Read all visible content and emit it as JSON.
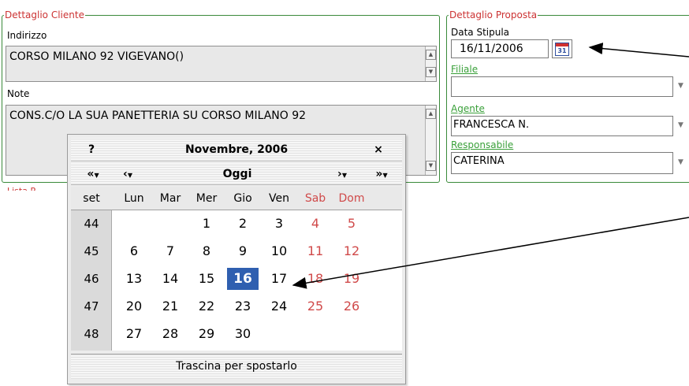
{
  "cliente": {
    "legend": "Dettaglio Cliente",
    "indirizzo_label": "Indirizzo",
    "indirizzo_value": "CORSO MILANO 92 VIGEVANO()",
    "note_label": "Note",
    "note_value": "CONS.C/O LA SUA PANETTERIA SU CORSO MILANO 92",
    "partial_label": "Lista P"
  },
  "proposta": {
    "legend": "Dettaglio Proposta",
    "data_stipula_label": "Data Stipula",
    "data_stipula_value": "16/11/2006",
    "calendar_icon_text": "31",
    "filiale_label": "Filiale",
    "filiale_value": "",
    "agente_label": "Agente",
    "agente_value": "FRANCESCA N.",
    "responsabile_label": "Responsabile",
    "responsabile_value": "CATERINA"
  },
  "calendar": {
    "help": "?",
    "title": "Novembre, 2006",
    "close": "×",
    "prev_year": "«",
    "prev_month": "‹",
    "today": "Oggi",
    "next_month": "›",
    "next_year": "»",
    "week_header": "set",
    "weekdays": [
      "Lun",
      "Mar",
      "Mer",
      "Gio",
      "Ven",
      "Sab",
      "Dom"
    ],
    "weeks": [
      {
        "week": "44",
        "days": [
          "",
          "",
          "1",
          "2",
          "3",
          "4",
          "5"
        ]
      },
      {
        "week": "45",
        "days": [
          "6",
          "7",
          "8",
          "9",
          "10",
          "11",
          "12"
        ]
      },
      {
        "week": "46",
        "days": [
          "13",
          "14",
          "15",
          "16",
          "17",
          "18",
          "19"
        ]
      },
      {
        "week": "47",
        "days": [
          "20",
          "21",
          "22",
          "23",
          "24",
          "25",
          "26"
        ]
      },
      {
        "week": "48",
        "days": [
          "27",
          "28",
          "29",
          "30",
          "",
          "",
          ""
        ]
      }
    ],
    "selected_day": "16",
    "footer": "Trascina per spostarlo"
  },
  "colors": {
    "border_green": "#3a8a3a",
    "legend_red": "#cc3333",
    "weekend_red": "#d04a4a",
    "selected_blue": "#2f5fb0",
    "label_green": "#3aa03a"
  }
}
